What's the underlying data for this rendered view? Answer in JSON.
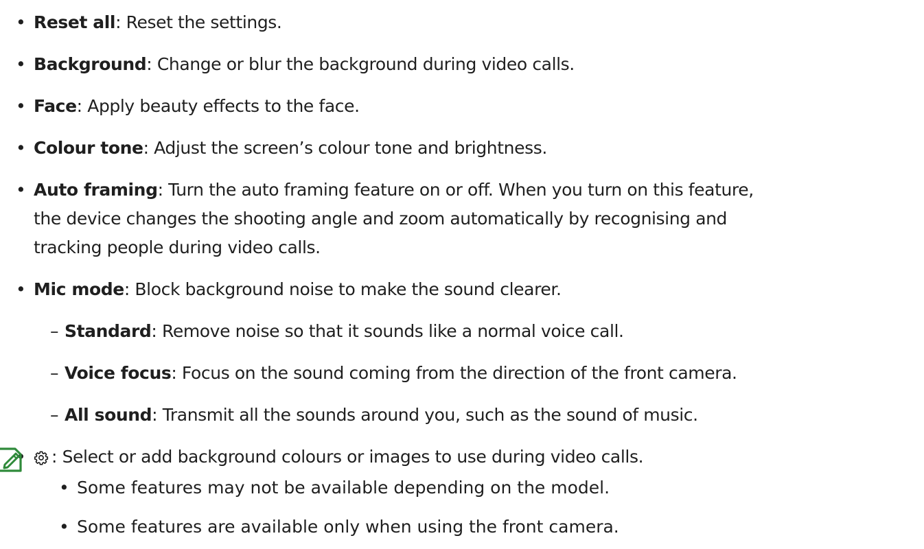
{
  "items": [
    {
      "term": "Reset all",
      "desc": ": Reset the settings."
    },
    {
      "term": "Background",
      "desc": ": Change or blur the background during video calls."
    },
    {
      "term": "Face",
      "desc": ": Apply beauty effects to the face."
    },
    {
      "term": "Colour tone",
      "desc": ": Adjust the screen’s colour tone and brightness."
    },
    {
      "term": "Auto framing",
      "desc": ": Turn the auto framing feature on or off. When you turn on this feature,",
      "desc_line2": "the device changes the shooting angle and zoom automatically by recognising and",
      "desc_line3": "tracking people during video calls."
    },
    {
      "term": "Mic mode",
      "desc": ": Block background noise to make the sound clearer."
    }
  ],
  "mic_modes": [
    {
      "term": "Standard",
      "desc": ": Remove noise so that it sounds like a normal voice call."
    },
    {
      "term": "Voice focus",
      "desc": ": Focus on the sound coming from the direction of the front camera."
    },
    {
      "term": "All sound",
      "desc": ": Transmit all the sounds around you, such as the sound of music."
    }
  ],
  "settings_item": {
    "icon": "gear-icon",
    "desc": ": Select or add background colours or images to use during video calls."
  },
  "notes": {
    "icon": "note-pencil-icon",
    "items": [
      "Some features may not be available depending on the model.",
      "Some features are available only when using the front camera."
    ]
  },
  "colors": {
    "text": "#1f1f1f",
    "note_icon": "#2f8a3a"
  }
}
